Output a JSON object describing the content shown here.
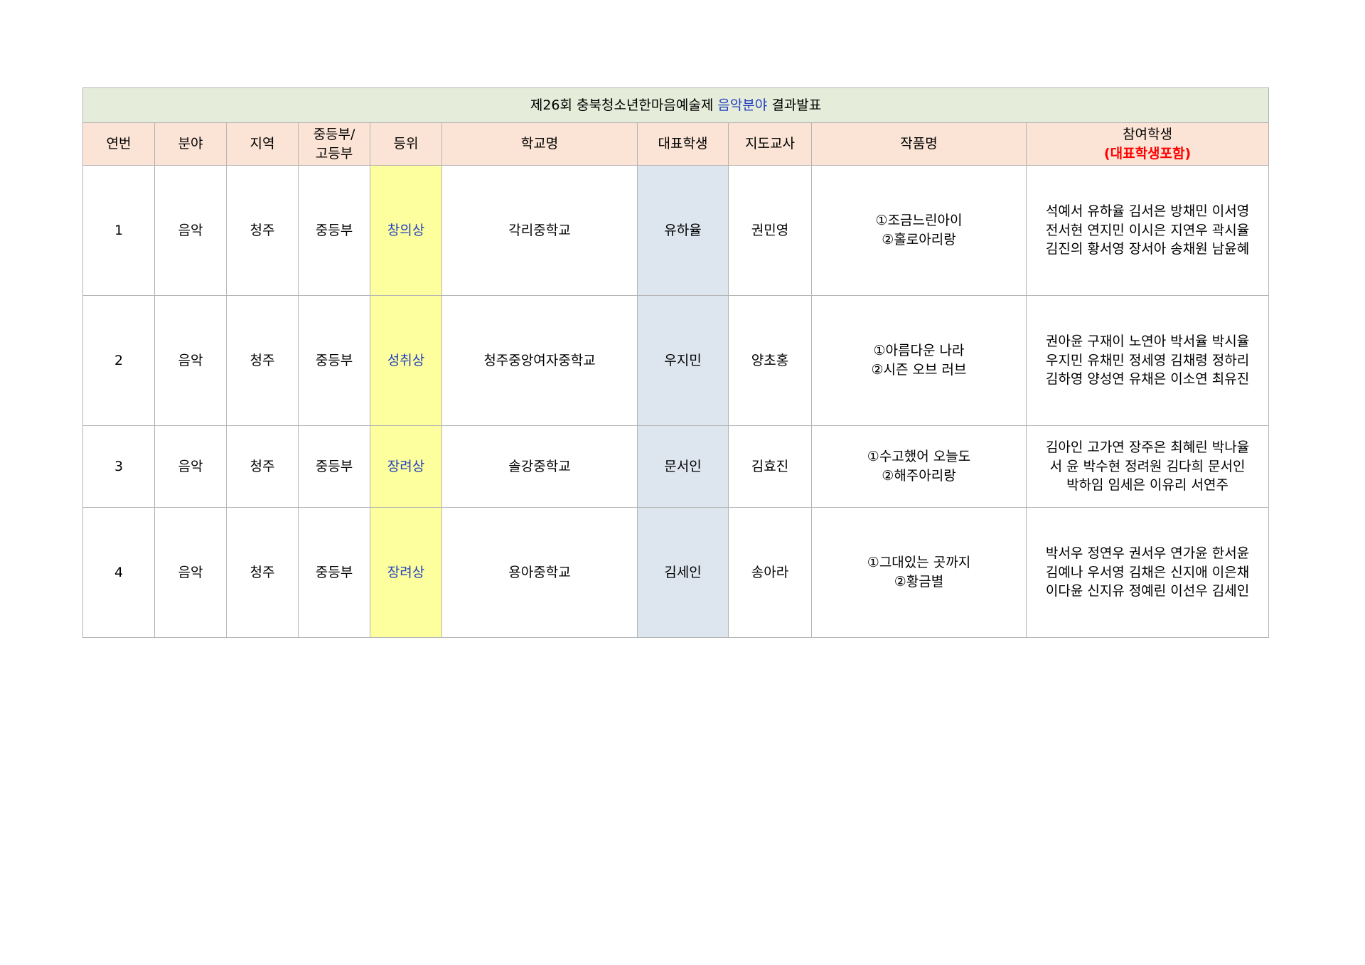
{
  "title": {
    "prefix": "제26회 충북청소년한마음예술제",
    "accent": "음악분야",
    "suffix": "결과발표"
  },
  "headers": {
    "no": "연번",
    "field": "분야",
    "region": "지역",
    "division_line1": "중등부/",
    "division_line2": "고등부",
    "award": "등위",
    "school": "학교명",
    "representative": "대표학생",
    "teacher": "지도교사",
    "works": "작품명",
    "participants": "참여학생",
    "participants_note": "(대표학생포함)"
  },
  "colors": {
    "title_background": "#e5ecd9",
    "header_background": "#fbe4d5",
    "award_background": "#fdfe9d",
    "award_text": "#1f3fc0",
    "representative_background": "#dde6ef",
    "note_text": "#ff0000",
    "grid_line": "#b4b4b4"
  },
  "rows": [
    {
      "no": "1",
      "field": "음악",
      "region": "청주",
      "division": "중등부",
      "award": "창의상",
      "school": "각리중학교",
      "representative": "유하율",
      "teacher": "권민영",
      "works": [
        "①조금느린아이",
        "②홀로아리랑"
      ],
      "participants": [
        "석예서 유하율 김서은 방채민 이서영",
        "전서현 연지민 이시은 지연우 곽시율",
        "김진의 황서영 장서아 송채원 남윤혜"
      ]
    },
    {
      "no": "2",
      "field": "음악",
      "region": "청주",
      "division": "중등부",
      "award": "성취상",
      "school": "청주중앙여자중학교",
      "representative": "우지민",
      "teacher": "양초홍",
      "works": [
        "①아름다운 나라",
        "②시즌 오브 러브"
      ],
      "participants": [
        "권아윤 구재이 노연아 박서율 박시율",
        "우지민 유채민 정세영 김채령 정하리",
        "김하영 양성연 유채은 이소연 최유진"
      ]
    },
    {
      "no": "3",
      "field": "음악",
      "region": "청주",
      "division": "중등부",
      "award": "장려상",
      "school": "솔강중학교",
      "representative": "문서인",
      "teacher": "김효진",
      "works": [
        "①수고했어 오늘도",
        "②해주아리랑"
      ],
      "participants": [
        "김아인 고가연 장주은 최혜린 박나율",
        "서 윤 박수현 정려원 김다희 문서인",
        "박하임 임세은 이유리 서연주"
      ]
    },
    {
      "no": "4",
      "field": "음악",
      "region": "청주",
      "division": "중등부",
      "award": "장려상",
      "school": "용아중학교",
      "representative": "김세인",
      "teacher": "송아라",
      "works": [
        "①그대있는 곳까지",
        "②황금별"
      ],
      "participants": [
        "박서우 정연우 권서우 연가윤 한서윤",
        "김예나 우서영 김채은 신지애 이은채",
        "이다윤 신지유 정예린 이선우 김세인"
      ]
    }
  ]
}
